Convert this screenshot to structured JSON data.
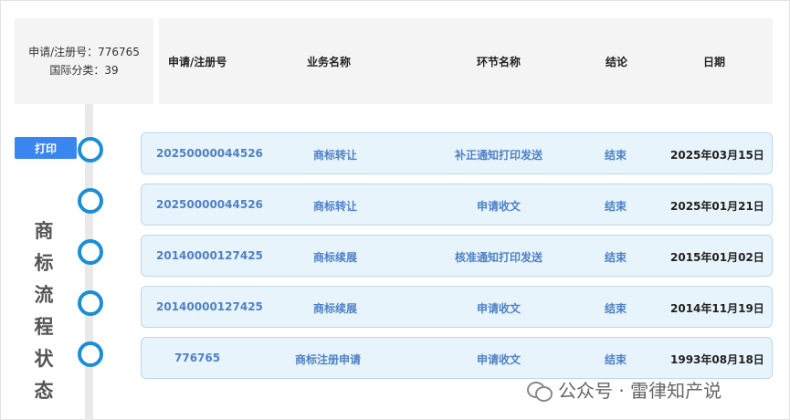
{
  "info": {
    "reg_no_label": "申请/注册号：776765",
    "class_label": "国际分类：39"
  },
  "columns": [
    "申请/注册号",
    "业务名称",
    "环节名称",
    "结论",
    "日期"
  ],
  "print_label": "打印",
  "side_title": [
    "商",
    "标",
    "流",
    "程",
    "状",
    "态"
  ],
  "rows": [
    {
      "reg_no": "20250000044526",
      "business": "商标转让",
      "stage": "补正通知打印发送",
      "result": "结束",
      "date": "2025年03月15日"
    },
    {
      "reg_no": "20250000044526",
      "business": "商标转让",
      "stage": "申请收文",
      "result": "结束",
      "date": "2025年01月21日"
    },
    {
      "reg_no": "20140000127425",
      "business": "商标续展",
      "stage": "核准通知打印发送",
      "result": "结束",
      "date": "2015年01月02日"
    },
    {
      "reg_no": "20140000127425",
      "business": "商标续展",
      "stage": "申请收文",
      "result": "结束",
      "date": "2014年11月19日"
    },
    {
      "reg_no": "776765",
      "business": "商标注册申请",
      "stage": "申请收文",
      "result": "结束",
      "date": "1993年08月18日"
    }
  ],
  "watermark": "公众号 · 雷律知产说",
  "icons": {
    "watermark": "wechat-icon"
  },
  "colors": {
    "accent": "#3a86f0",
    "node": "#1a8ed6",
    "row_bg": "#e8f4fb",
    "link": "#4f81c7"
  }
}
